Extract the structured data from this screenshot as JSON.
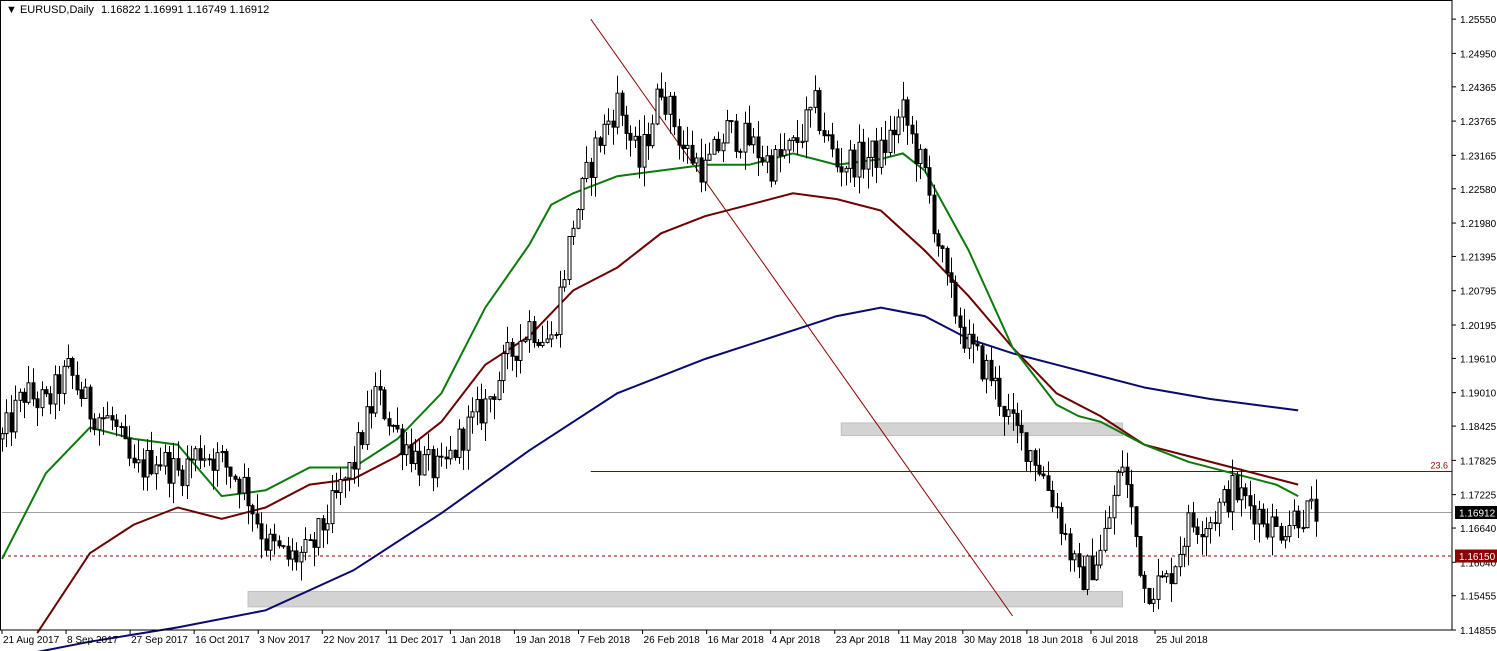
{
  "header": {
    "symbol": "EURUSD,Daily",
    "ohlc": "1.16822 1.16991 1.16749 1.16912"
  },
  "colors": {
    "background": "#ffffff",
    "axis": "#000000",
    "candle": "#000000",
    "ma_fast": "#0b7a0b",
    "ma_mid": "#6e0000",
    "ma_slow": "#0a0a6e",
    "zone": "#d3d3d3",
    "fib_line": "#8b0000",
    "current_price_line": "#a0a0a0",
    "level_line": "#8b0000",
    "level_label_bg": "#8b0000",
    "price_label_bg": "#000000"
  },
  "chart_data": {
    "type": "candlestick",
    "ylim": [
      1.14855,
      1.2585
    ],
    "y_ticks": [
      "1.25550",
      "1.24950",
      "1.24365",
      "1.23765",
      "1.23165",
      "1.22580",
      "1.21980",
      "1.21395",
      "1.20795",
      "1.20195",
      "1.19610",
      "1.19010",
      "1.18425",
      "1.17825",
      "1.17225",
      "1.16640",
      "1.16040",
      "1.15455",
      "1.14855"
    ],
    "x_ticks": [
      "21 Aug 2017",
      "8 Sep 2017",
      "27 Sep 2017",
      "16 Oct 2017",
      "3 Nov 2017",
      "22 Nov 2017",
      "11 Dec 2017",
      "1 Jan 2018",
      "19 Jan 2018",
      "7 Feb 2018",
      "26 Feb 2018",
      "16 Mar 2018",
      "4 Apr 2018",
      "23 Apr 2018",
      "11 May 2018",
      "30 May 2018",
      "18 Jun 2018",
      "6 Jul 2018",
      "25 Jul 2018"
    ],
    "close_path": [
      [
        0,
        1.182
      ],
      [
        5,
        1.19
      ],
      [
        10,
        1.188
      ],
      [
        15,
        1.194
      ],
      [
        20,
        1.187
      ],
      [
        25,
        1.185
      ],
      [
        30,
        1.176
      ],
      [
        35,
        1.179
      ],
      [
        40,
        1.176
      ],
      [
        45,
        1.18
      ],
      [
        50,
        1.178
      ],
      [
        55,
        1.174
      ],
      [
        60,
        1.164
      ],
      [
        65,
        1.161
      ],
      [
        70,
        1.162
      ],
      [
        75,
        1.17
      ],
      [
        80,
        1.178
      ],
      [
        85,
        1.19
      ],
      [
        90,
        1.183
      ],
      [
        95,
        1.178
      ],
      [
        100,
        1.176
      ],
      [
        105,
        1.183
      ],
      [
        110,
        1.188
      ],
      [
        115,
        1.196
      ],
      [
        120,
        1.202
      ],
      [
        125,
        1.199
      ],
      [
        130,
        1.22
      ],
      [
        135,
        1.233
      ],
      [
        140,
        1.241
      ],
      [
        145,
        1.23
      ],
      [
        150,
        1.244
      ],
      [
        155,
        1.233
      ],
      [
        160,
        1.229
      ],
      [
        165,
        1.236
      ],
      [
        170,
        1.234
      ],
      [
        175,
        1.23
      ],
      [
        180,
        1.233
      ],
      [
        185,
        1.24
      ],
      [
        190,
        1.23
      ],
      [
        195,
        1.231
      ],
      [
        200,
        1.232
      ],
      [
        205,
        1.239
      ],
      [
        210,
        1.228
      ],
      [
        215,
        1.209
      ],
      [
        220,
        1.198
      ],
      [
        225,
        1.193
      ],
      [
        230,
        1.184
      ],
      [
        235,
        1.179
      ],
      [
        240,
        1.17
      ],
      [
        245,
        1.157
      ],
      [
        250,
        1.162
      ],
      [
        255,
        1.178
      ],
      [
        260,
        1.156
      ],
      [
        265,
        1.157
      ],
      [
        270,
        1.167
      ],
      [
        275,
        1.168
      ],
      [
        280,
        1.173
      ],
      [
        285,
        1.17
      ],
      [
        290,
        1.166
      ],
      [
        295,
        1.169
      ],
      [
        299,
        1.1691
      ]
    ],
    "ma_fast": [
      [
        0,
        1.161
      ],
      [
        10,
        1.176
      ],
      [
        20,
        1.184
      ],
      [
        30,
        1.182
      ],
      [
        40,
        1.181
      ],
      [
        50,
        1.172
      ],
      [
        60,
        1.173
      ],
      [
        70,
        1.177
      ],
      [
        80,
        1.177
      ],
      [
        90,
        1.182
      ],
      [
        100,
        1.19
      ],
      [
        110,
        1.205
      ],
      [
        120,
        1.216
      ],
      [
        125,
        1.223
      ],
      [
        130,
        1.225
      ],
      [
        140,
        1.228
      ],
      [
        150,
        1.229
      ],
      [
        160,
        1.23
      ],
      [
        170,
        1.23
      ],
      [
        180,
        1.232
      ],
      [
        190,
        1.23
      ],
      [
        200,
        1.231
      ],
      [
        205,
        1.232
      ],
      [
        210,
        1.229
      ],
      [
        220,
        1.215
      ],
      [
        230,
        1.198
      ],
      [
        240,
        1.188
      ],
      [
        245,
        1.186
      ],
      [
        250,
        1.185
      ],
      [
        260,
        1.181
      ],
      [
        270,
        1.178
      ],
      [
        280,
        1.176
      ],
      [
        290,
        1.174
      ],
      [
        295,
        1.172
      ]
    ],
    "ma_mid": [
      [
        8,
        1.148
      ],
      [
        20,
        1.162
      ],
      [
        30,
        1.167
      ],
      [
        40,
        1.17
      ],
      [
        50,
        1.168
      ],
      [
        60,
        1.17
      ],
      [
        70,
        1.174
      ],
      [
        80,
        1.175
      ],
      [
        90,
        1.179
      ],
      [
        100,
        1.185
      ],
      [
        110,
        1.195
      ],
      [
        120,
        1.2
      ],
      [
        130,
        1.208
      ],
      [
        140,
        1.212
      ],
      [
        150,
        1.218
      ],
      [
        160,
        1.221
      ],
      [
        170,
        1.223
      ],
      [
        180,
        1.225
      ],
      [
        190,
        1.224
      ],
      [
        200,
        1.222
      ],
      [
        210,
        1.215
      ],
      [
        220,
        1.207
      ],
      [
        230,
        1.198
      ],
      [
        240,
        1.19
      ],
      [
        250,
        1.186
      ],
      [
        260,
        1.181
      ],
      [
        270,
        1.179
      ],
      [
        280,
        1.177
      ],
      [
        290,
        1.175
      ],
      [
        295,
        1.174
      ]
    ],
    "ma_slow": [
      [
        0,
        1.1435
      ],
      [
        20,
        1.1465
      ],
      [
        40,
        1.149
      ],
      [
        60,
        1.152
      ],
      [
        80,
        1.159
      ],
      [
        100,
        1.169
      ],
      [
        120,
        1.18
      ],
      [
        140,
        1.19
      ],
      [
        160,
        1.196
      ],
      [
        180,
        1.201
      ],
      [
        190,
        1.2035
      ],
      [
        200,
        1.205
      ],
      [
        210,
        1.2035
      ],
      [
        220,
        1.1995
      ],
      [
        230,
        1.197
      ],
      [
        240,
        1.195
      ],
      [
        250,
        1.193
      ],
      [
        260,
        1.191
      ],
      [
        275,
        1.189
      ],
      [
        290,
        1.1875
      ],
      [
        295,
        1.187
      ]
    ],
    "zones": [
      {
        "x0": 56,
        "x1": 255,
        "y0": 1.1553,
        "y1": 1.1526
      },
      {
        "x0": 191,
        "x1": 255,
        "y0": 1.1848,
        "y1": 1.1826
      }
    ],
    "trendline": {
      "x0": 134,
      "y0": 1.2555,
      "x1": 230,
      "y1": 1.151
    },
    "fib_level": {
      "x0": 134,
      "x1": 330,
      "y": 1.1763,
      "label": "23.6"
    },
    "current_price": {
      "value": 1.16912,
      "label": "1.16912"
    },
    "level_line": {
      "value": 1.1615,
      "label": "1.16150"
    },
    "x_range": [
      0,
      330
    ]
  }
}
